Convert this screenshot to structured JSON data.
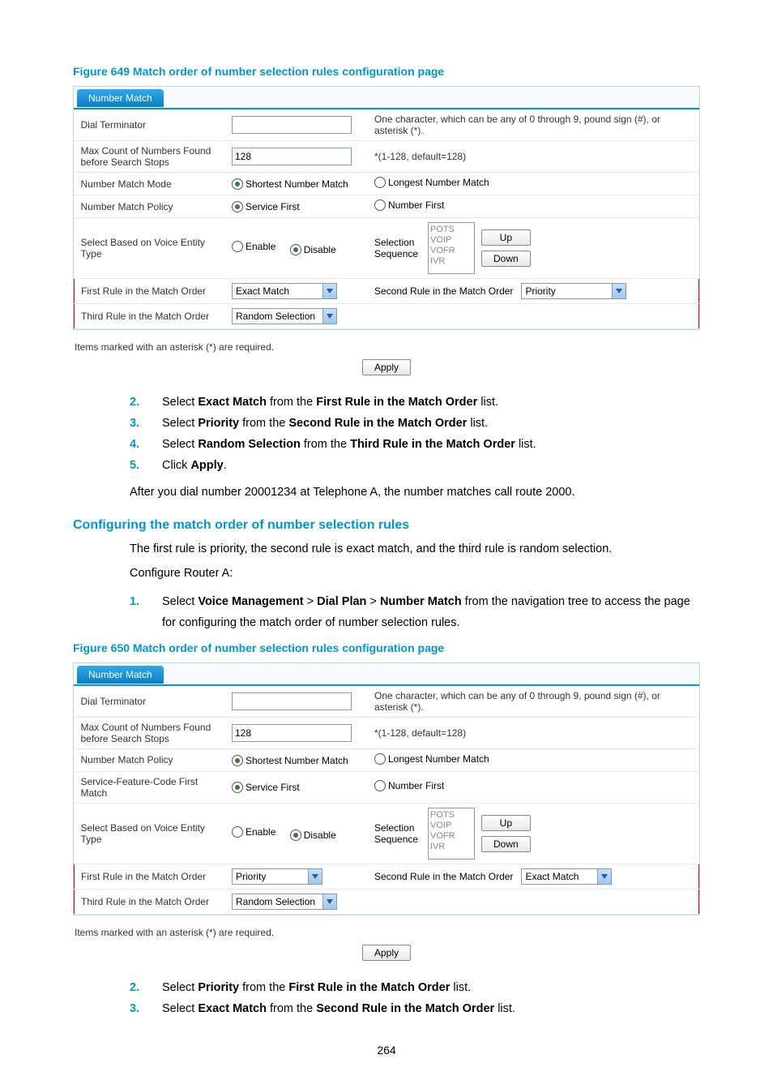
{
  "figure649": {
    "title": "Figure 649 Match order of number selection rules configuration page",
    "tab": "Number Match",
    "dialTerminatorLabel": "Dial Terminator",
    "dialTerminatorHint": "One character, which can be any of 0 through 9, pound sign (#), or asterisk (*).",
    "maxCountLabel": "Max Count of Numbers Found before Search Stops",
    "maxCountValue": "128",
    "maxCountHint": "*(1-128, default=128)",
    "matchModeLabel": "Number Match Mode",
    "shortest": "Shortest Number Match",
    "longest": "Longest Number Match",
    "matchPolicyLabel": "Number Match Policy",
    "serviceFirst": "Service First",
    "numberFirst": "Number First",
    "selectEntityLabel": "Select Based on Voice Entity Type",
    "enable": "Enable",
    "disable": "Disable",
    "seqLabel": "Selection Sequence",
    "seqOptions": "POTS\nVOIP\nVOFR\nIVR",
    "up": "Up",
    "down": "Down",
    "firstRuleLabel": "First Rule in the Match Order",
    "firstRuleValue": "Exact Match",
    "secondRuleLabel": "Second Rule in the Match Order",
    "secondRuleValue": "Priority",
    "thirdRuleLabel": "Third Rule in the Match Order",
    "thirdRuleValue": "Random Selection",
    "requiredNote": "Items marked with an asterisk (*) are required.",
    "apply": "Apply"
  },
  "steps1": [
    {
      "n": "2.",
      "pre": "Select ",
      "b1": "Exact Match",
      "mid": " from the ",
      "b2": "First Rule in the Match Order",
      "post": " list."
    },
    {
      "n": "3.",
      "pre": "Select ",
      "b1": "Priority",
      "mid": " from the ",
      "b2": "Second Rule in the Match Order",
      "post": " list."
    },
    {
      "n": "4.",
      "pre": "Select ",
      "b1": "Random Selection",
      "mid": " from the ",
      "b2": "Third Rule in the Match Order",
      "post": " list."
    },
    {
      "n": "5.",
      "pre": "Click ",
      "b1": "Apply",
      "mid": "",
      "b2": "",
      "post": "."
    }
  ],
  "afterDial": "After you dial number 20001234 at Telephone A, the number matches call route 2000.",
  "sectionTitle": "Configuring the match order of number selection rules",
  "sectionIntro": "The first rule is priority, the second rule is exact match, and the third rule is random selection.",
  "configRouter": "Configure Router A:",
  "step1Line": {
    "n": "1.",
    "pre": "Select ",
    "b1": "Voice Management",
    "gt1": " > ",
    "b2": "Dial Plan",
    "gt2": " > ",
    "b3": "Number Match",
    "post": " from the navigation tree to access the page for configuring the match order of number selection rules."
  },
  "figure650": {
    "title": "Figure 650 Match order of number selection rules configuration page",
    "tab": "Number Match",
    "dialTerminatorLabel": "Dial Terminator",
    "dialTerminatorHint": "One character, which can be any of 0 through 9, pound sign (#), or asterisk (*).",
    "maxCountLabel": "Max Count of Numbers Found before Search Stops",
    "maxCountValue": "128",
    "maxCountHint": "*(1-128, default=128)",
    "matchPolicyLabel": "Number Match Policy",
    "shortest": "Shortest Number Match",
    "longest": "Longest Number Match",
    "serviceCodeLabel": "Service-Feature-Code First Match",
    "serviceFirst": "Service First",
    "numberFirst": "Number First",
    "selectEntityLabel": "Select Based on Voice Entity Type",
    "enable": "Enable",
    "disable": "Disable",
    "seqLabel": "Selection Sequence",
    "seqOptions": "POTS\nVOIP\nVOFR\nIVR",
    "up": "Up",
    "down": "Down",
    "firstRuleLabel": "First Rule in the Match Order",
    "firstRuleValue": "Priority",
    "secondRuleLabel": "Second Rule in the Match Order",
    "secondRuleValue": "Exact Match",
    "thirdRuleLabel": "Third Rule in the Match Order",
    "thirdRuleValue": "Random Selection",
    "requiredNote": "Items marked with an asterisk (*) are required.",
    "apply": "Apply"
  },
  "steps2": [
    {
      "n": "2.",
      "pre": "Select ",
      "b1": "Priority",
      "mid": " from the ",
      "b2": "First Rule in the Match Order",
      "post": " list."
    },
    {
      "n": "3.",
      "pre": "Select ",
      "b1": "Exact Match",
      "mid": " from the ",
      "b2": "Second Rule in the Match Order",
      "post": " list."
    }
  ],
  "pageNumber": "264"
}
